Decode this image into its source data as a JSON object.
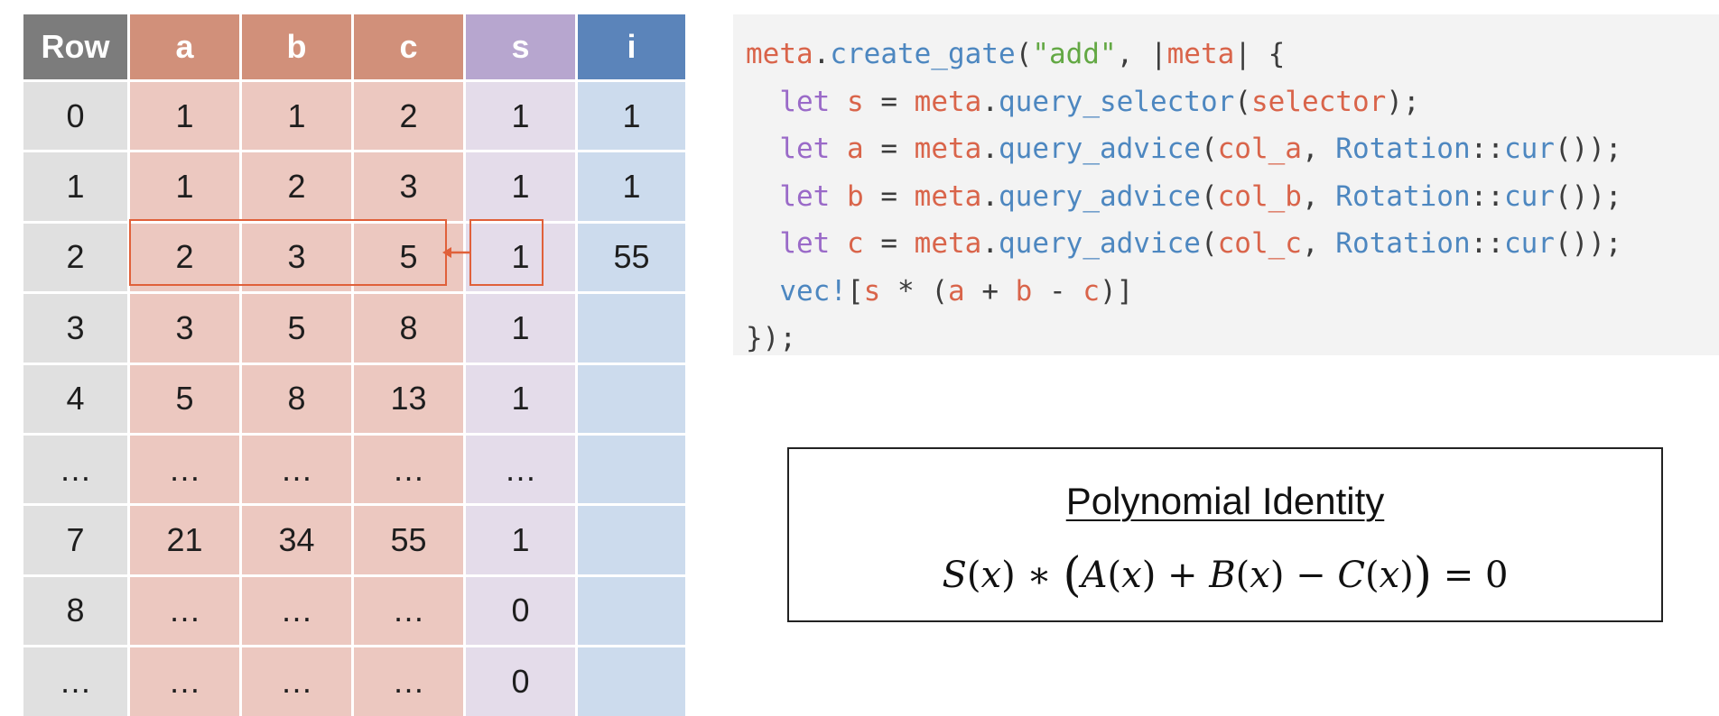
{
  "table": {
    "headers": [
      "Row",
      "a",
      "b",
      "c",
      "s",
      "i"
    ],
    "rows": [
      [
        "0",
        "1",
        "1",
        "2",
        "1",
        "1"
      ],
      [
        "1",
        "1",
        "2",
        "3",
        "1",
        "1"
      ],
      [
        "2",
        "2",
        "3",
        "5",
        "1",
        "55"
      ],
      [
        "3",
        "3",
        "5",
        "8",
        "1",
        ""
      ],
      [
        "4",
        "5",
        "8",
        "13",
        "1",
        ""
      ],
      [
        "…",
        "…",
        "…",
        "…",
        "…",
        ""
      ],
      [
        "7",
        "21",
        "34",
        "55",
        "1",
        ""
      ],
      [
        "8",
        "…",
        "…",
        "…",
        "0",
        ""
      ],
      [
        "…",
        "…",
        "…",
        "…",
        "0",
        ""
      ]
    ],
    "highlighted_row": "2",
    "colors": {
      "row_header": "#7c7c7c",
      "advice_header": "#d1907a",
      "selector_header": "#b7a6cf",
      "instance_header": "#5b84ba",
      "highlight": "#e0603a"
    }
  },
  "code": {
    "lines": [
      [
        {
          "t": "meta",
          "c": "obj"
        },
        {
          "t": ".",
          "c": "pun"
        },
        {
          "t": "create_gate",
          "c": "fn"
        },
        {
          "t": "(",
          "c": "pun"
        },
        {
          "t": "\"add\"",
          "c": "str"
        },
        {
          "t": ", |",
          "c": "pun"
        },
        {
          "t": "meta",
          "c": "var"
        },
        {
          "t": "| {",
          "c": "pun"
        }
      ],
      [
        {
          "t": "  ",
          "c": "pun"
        },
        {
          "t": "let",
          "c": "kw"
        },
        {
          "t": " ",
          "c": "pun"
        },
        {
          "t": "s",
          "c": "var"
        },
        {
          "t": " = ",
          "c": "pun"
        },
        {
          "t": "meta",
          "c": "obj"
        },
        {
          "t": ".",
          "c": "pun"
        },
        {
          "t": "query_selector",
          "c": "fn"
        },
        {
          "t": "(",
          "c": "pun"
        },
        {
          "t": "selector",
          "c": "var"
        },
        {
          "t": ");",
          "c": "pun"
        }
      ],
      [
        {
          "t": "  ",
          "c": "pun"
        },
        {
          "t": "let",
          "c": "kw"
        },
        {
          "t": " ",
          "c": "pun"
        },
        {
          "t": "a",
          "c": "var"
        },
        {
          "t": " = ",
          "c": "pun"
        },
        {
          "t": "meta",
          "c": "obj"
        },
        {
          "t": ".",
          "c": "pun"
        },
        {
          "t": "query_advice",
          "c": "fn"
        },
        {
          "t": "(",
          "c": "pun"
        },
        {
          "t": "col_a",
          "c": "var"
        },
        {
          "t": ", ",
          "c": "pun"
        },
        {
          "t": "Rotation",
          "c": "typ"
        },
        {
          "t": "::",
          "c": "pun"
        },
        {
          "t": "cur",
          "c": "fn"
        },
        {
          "t": "());",
          "c": "pun"
        }
      ],
      [
        {
          "t": "  ",
          "c": "pun"
        },
        {
          "t": "let",
          "c": "kw"
        },
        {
          "t": " ",
          "c": "pun"
        },
        {
          "t": "b",
          "c": "var"
        },
        {
          "t": " = ",
          "c": "pun"
        },
        {
          "t": "meta",
          "c": "obj"
        },
        {
          "t": ".",
          "c": "pun"
        },
        {
          "t": "query_advice",
          "c": "fn"
        },
        {
          "t": "(",
          "c": "pun"
        },
        {
          "t": "col_b",
          "c": "var"
        },
        {
          "t": ", ",
          "c": "pun"
        },
        {
          "t": "Rotation",
          "c": "typ"
        },
        {
          "t": "::",
          "c": "pun"
        },
        {
          "t": "cur",
          "c": "fn"
        },
        {
          "t": "());",
          "c": "pun"
        }
      ],
      [
        {
          "t": "  ",
          "c": "pun"
        },
        {
          "t": "let",
          "c": "kw"
        },
        {
          "t": " ",
          "c": "pun"
        },
        {
          "t": "c",
          "c": "var"
        },
        {
          "t": " = ",
          "c": "pun"
        },
        {
          "t": "meta",
          "c": "obj"
        },
        {
          "t": ".",
          "c": "pun"
        },
        {
          "t": "query_advice",
          "c": "fn"
        },
        {
          "t": "(",
          "c": "pun"
        },
        {
          "t": "col_c",
          "c": "var"
        },
        {
          "t": ", ",
          "c": "pun"
        },
        {
          "t": "Rotation",
          "c": "typ"
        },
        {
          "t": "::",
          "c": "pun"
        },
        {
          "t": "cur",
          "c": "fn"
        },
        {
          "t": "());",
          "c": "pun"
        }
      ],
      [
        {
          "t": "  ",
          "c": "pun"
        },
        {
          "t": "vec!",
          "c": "fn"
        },
        {
          "t": "[",
          "c": "pun"
        },
        {
          "t": "s",
          "c": "var"
        },
        {
          "t": " * (",
          "c": "pun"
        },
        {
          "t": "a",
          "c": "var"
        },
        {
          "t": " + ",
          "c": "pun"
        },
        {
          "t": "b",
          "c": "var"
        },
        {
          "t": " - ",
          "c": "pun"
        },
        {
          "t": "c",
          "c": "var"
        },
        {
          "t": ")]",
          "c": "pun"
        }
      ],
      [
        {
          "t": "});",
          "c": "pun"
        }
      ]
    ],
    "colors": {
      "obj": "#d9644a",
      "fn": "#4d87c0",
      "str": "#63a844",
      "kw": "#9a6ac8",
      "var": "#d9644a",
      "typ": "#4d87c0",
      "pun": "#3c3c3c"
    }
  },
  "identity": {
    "title": "Polynomial Identity",
    "formula": {
      "s": "S",
      "a": "A",
      "b": "B",
      "c": "C",
      "x": "x",
      "mul": "∗",
      "plus": "+",
      "minus": "−",
      "equals": "=",
      "zero": "0"
    }
  }
}
